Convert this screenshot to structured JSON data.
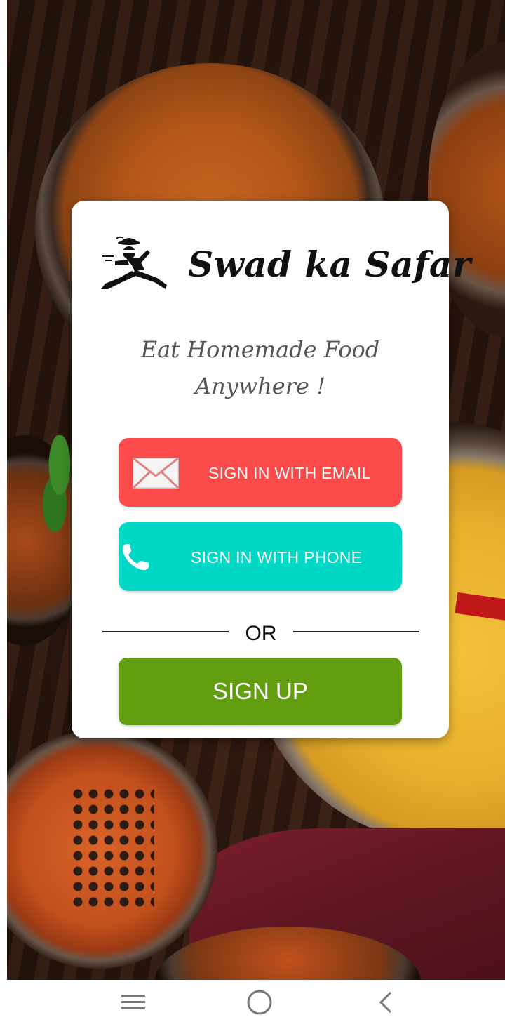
{
  "app": {
    "brand_name": "Swad ka Safar",
    "tagline_line1": "Eat Homemade Food",
    "tagline_line2": "Anywhere !",
    "logo_icon": "delivery-runner-icon"
  },
  "auth": {
    "email_button": {
      "label": "SIGN IN WITH EMAIL",
      "icon": "mail-icon",
      "color": "#fa4a4a"
    },
    "phone_button": {
      "label": "SIGN IN WITH PHONE",
      "icon": "phone-icon",
      "color": "#00d7c5"
    },
    "divider_text": "OR",
    "signup_button": {
      "label": "SIGN UP",
      "color": "#629d10"
    }
  },
  "navbar": {
    "items": [
      {
        "name": "recent-apps",
        "icon": "menu-icon"
      },
      {
        "name": "home",
        "icon": "circle-home-icon"
      },
      {
        "name": "back",
        "icon": "chevron-left-icon"
      }
    ]
  }
}
